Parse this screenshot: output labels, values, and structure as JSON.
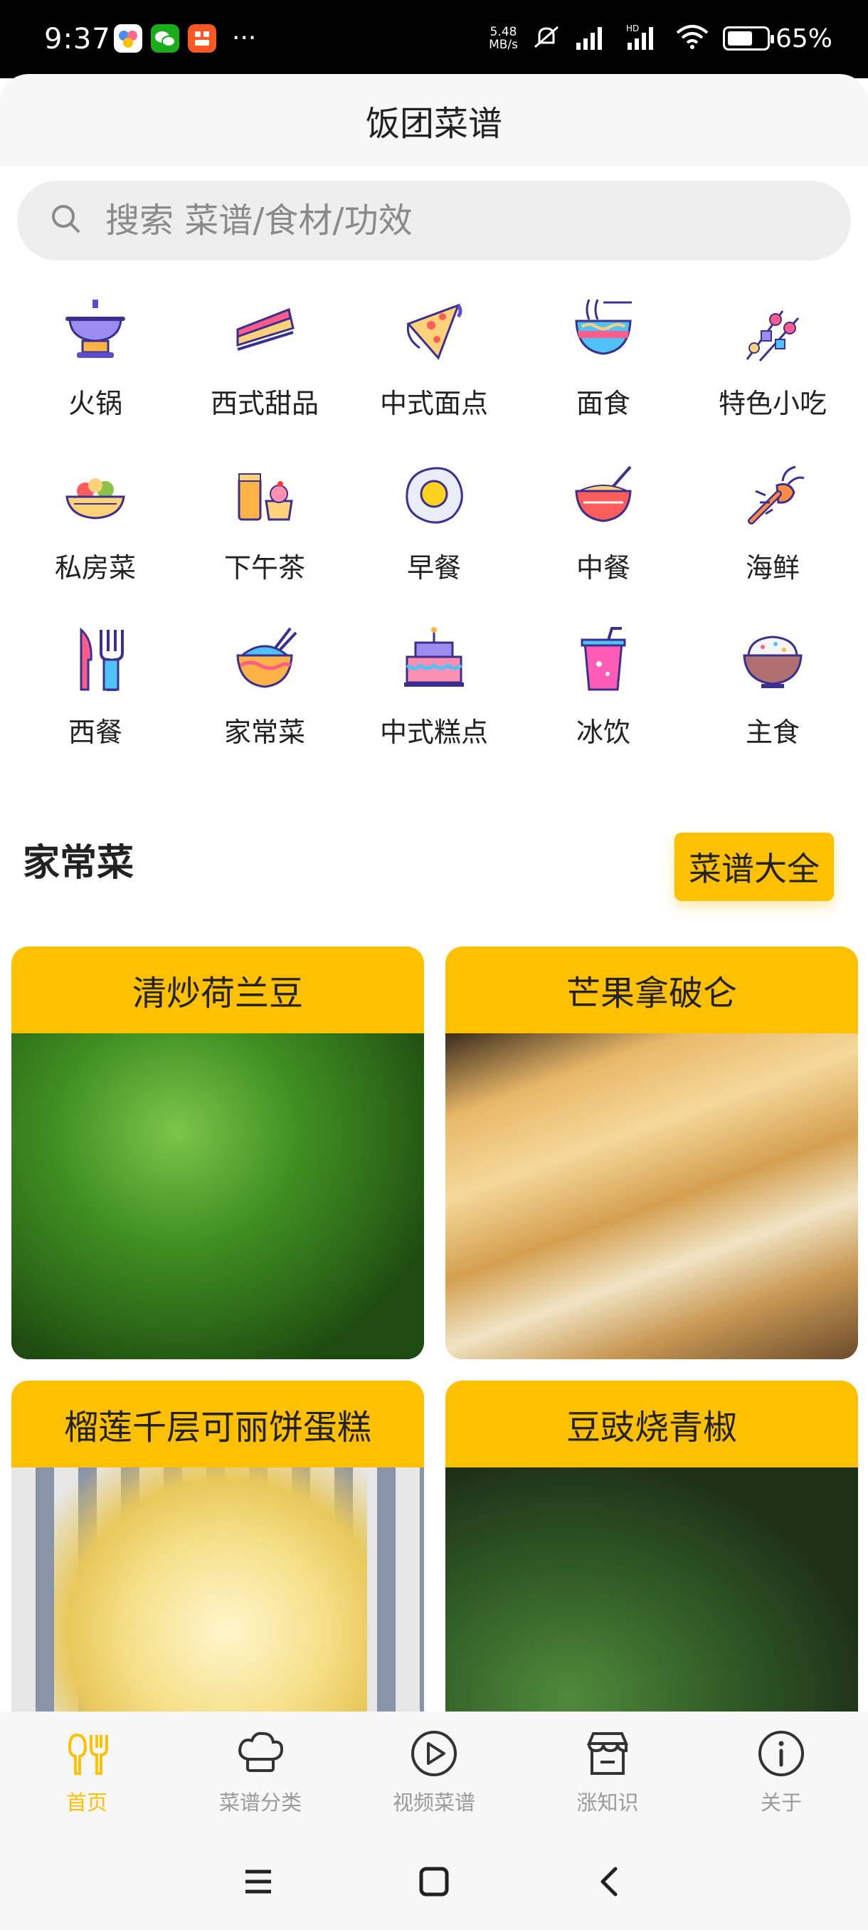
{
  "status_bar": {
    "time": "9:37",
    "net_speed_value": "5.48",
    "net_speed_unit": "MB/s",
    "battery": "65%",
    "battery_level": 0.65
  },
  "app": {
    "title": "饭团菜谱"
  },
  "search": {
    "placeholder": "搜索 菜谱/食材/功效"
  },
  "categories": [
    {
      "label": "火锅",
      "icon": "hotpot-icon"
    },
    {
      "label": "西式甜品",
      "icon": "cake-slice-icon"
    },
    {
      "label": "中式面点",
      "icon": "pizza-slice-icon"
    },
    {
      "label": "面食",
      "icon": "noodle-bowl-icon"
    },
    {
      "label": "特色小吃",
      "icon": "skewer-icon"
    },
    {
      "label": "私房菜",
      "icon": "fruit-basket-icon"
    },
    {
      "label": "下午茶",
      "icon": "tea-dessert-icon"
    },
    {
      "label": "早餐",
      "icon": "fried-egg-icon"
    },
    {
      "label": "中餐",
      "icon": "rice-bowl-chopsticks-icon"
    },
    {
      "label": "海鲜",
      "icon": "lobster-icon"
    },
    {
      "label": "西餐",
      "icon": "knife-fork-icon"
    },
    {
      "label": "家常菜",
      "icon": "home-bowl-icon"
    },
    {
      "label": "中式糕点",
      "icon": "birthday-cake-icon"
    },
    {
      "label": "冰饮",
      "icon": "cold-drink-icon"
    },
    {
      "label": "主食",
      "icon": "rice-icon"
    }
  ],
  "section": {
    "title": "家常菜",
    "more_button": "菜谱大全"
  },
  "recipes": [
    {
      "title": "清炒荷兰豆"
    },
    {
      "title": "芒果拿破仑"
    },
    {
      "title": "榴莲千层可丽饼蛋糕"
    },
    {
      "title": "豆豉烧青椒"
    }
  ],
  "bottom_nav": [
    {
      "label": "首页",
      "icon": "home-utensils-icon",
      "active": true
    },
    {
      "label": "菜谱分类",
      "icon": "chef-hat-icon",
      "active": false
    },
    {
      "label": "视频菜谱",
      "icon": "play-icon",
      "active": false
    },
    {
      "label": "涨知识",
      "icon": "shop-icon",
      "active": false
    },
    {
      "label": "关于",
      "icon": "info-icon",
      "active": false
    }
  ],
  "colors": {
    "accent": "#ffc000",
    "inactive": "#9a9a9a"
  }
}
